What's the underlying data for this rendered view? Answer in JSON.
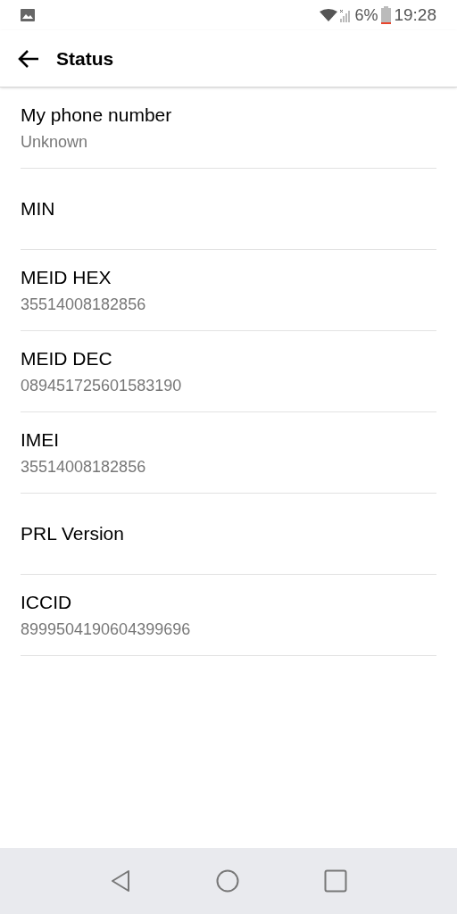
{
  "status_bar": {
    "battery": "6%",
    "time": "19:28"
  },
  "app_bar": {
    "title": "Status"
  },
  "items": [
    {
      "label": "My phone number",
      "value": "Unknown"
    },
    {
      "label": "MIN"
    },
    {
      "label": "MEID HEX",
      "value": "35514008182856"
    },
    {
      "label": "MEID DEC",
      "value": "089451725601583190"
    },
    {
      "label": "IMEI",
      "value": "35514008182856"
    },
    {
      "label": "PRL Version"
    },
    {
      "label": "ICCID",
      "value": "8999504190604399696"
    }
  ]
}
